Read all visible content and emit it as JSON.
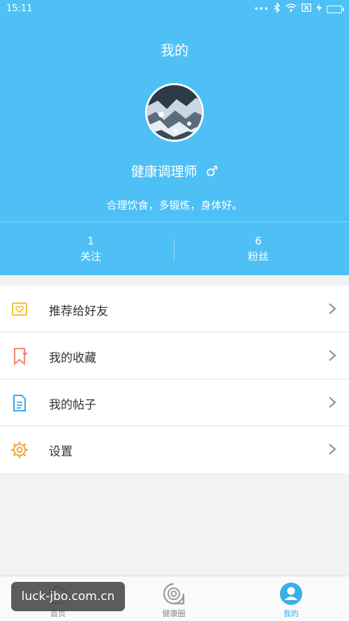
{
  "status_bar": {
    "time": "15:11"
  },
  "header": {
    "title": "我的",
    "username": "健康调理师",
    "gender_symbol": "♂",
    "bio": "合理饮食，多锻炼，身体好。"
  },
  "stats": [
    {
      "value": "1",
      "label": "关注"
    },
    {
      "value": "6",
      "label": "粉丝"
    }
  ],
  "menu": {
    "items": [
      {
        "label": "推荐给好友",
        "icon": "heart-card-icon",
        "color": "#f4c430"
      },
      {
        "label": "我的收藏",
        "icon": "bookmark-plus-icon",
        "color": "#f08c6a"
      },
      {
        "label": "我的帖子",
        "icon": "document-icon",
        "color": "#3aa8e6"
      },
      {
        "label": "设置",
        "icon": "gear-icon",
        "color": "#f2a83b"
      }
    ]
  },
  "tabbar": {
    "tabs": [
      {
        "label": "首页",
        "icon": "home-icon"
      },
      {
        "label": "健康圈",
        "icon": "circle-chat-icon"
      },
      {
        "label": "我的",
        "icon": "user-icon",
        "active": true
      }
    ]
  },
  "watermark": {
    "text": "luck-jbo.com.cn"
  },
  "colors": {
    "primary": "#4ec0f5",
    "active_tab": "#3aaee8"
  }
}
